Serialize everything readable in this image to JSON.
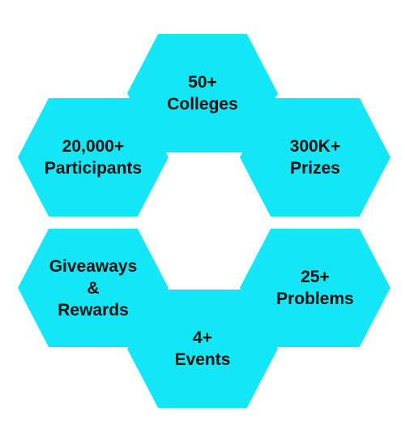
{
  "colors": {
    "hex_fill": "#13e7f7",
    "text": "#111111",
    "background": "#ffffff"
  },
  "stats": {
    "colleges": {
      "line1": "50+",
      "line2": "Colleges"
    },
    "participants": {
      "line1": "20,000+",
      "line2": "Participants"
    },
    "prizes": {
      "line1": "300K+",
      "line2": "Prizes"
    },
    "giveaways": {
      "line1": "Giveaways",
      "line2": "&",
      "line3": "Rewards"
    },
    "problems": {
      "line1": "25+",
      "line2": "Problems"
    },
    "events": {
      "line1": "4+",
      "line2": "Events"
    }
  }
}
